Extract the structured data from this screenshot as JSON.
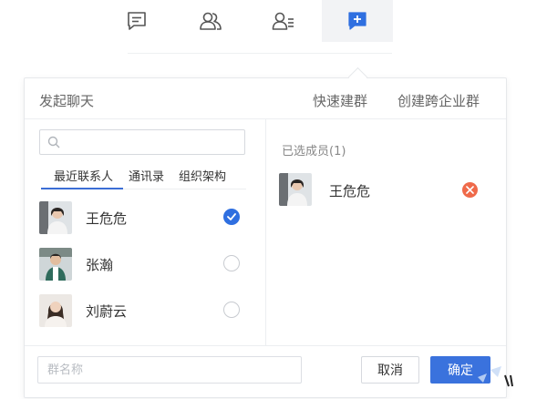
{
  "toolbar": {
    "items": [
      {
        "icon": "message-icon",
        "active": false
      },
      {
        "icon": "contacts-icon",
        "active": false
      },
      {
        "icon": "user-list-icon",
        "active": false
      },
      {
        "icon": "add-group-icon",
        "active": true
      }
    ]
  },
  "popup": {
    "title": "发起聊天",
    "quick_group": "快速建群",
    "cross_company_group": "创建跨企业群"
  },
  "left": {
    "search_placeholder": "",
    "tabs": [
      "最近联系人",
      "通讯录",
      "组织架构"
    ],
    "active_tab": 0,
    "contacts": [
      {
        "name": "王危危",
        "checked": true
      },
      {
        "name": "张瀚",
        "checked": false
      },
      {
        "name": "刘蔚云",
        "checked": false
      }
    ]
  },
  "right": {
    "selected_label": "已选成员(1)",
    "selected": [
      {
        "name": "王危危"
      }
    ]
  },
  "footer": {
    "group_name_placeholder": "群名称",
    "cancel_label": "取消",
    "ok_label": "确定"
  },
  "colors": {
    "accent": "#3a72dd",
    "check": "#2f6fe0",
    "remove": "#ef6a4a"
  }
}
